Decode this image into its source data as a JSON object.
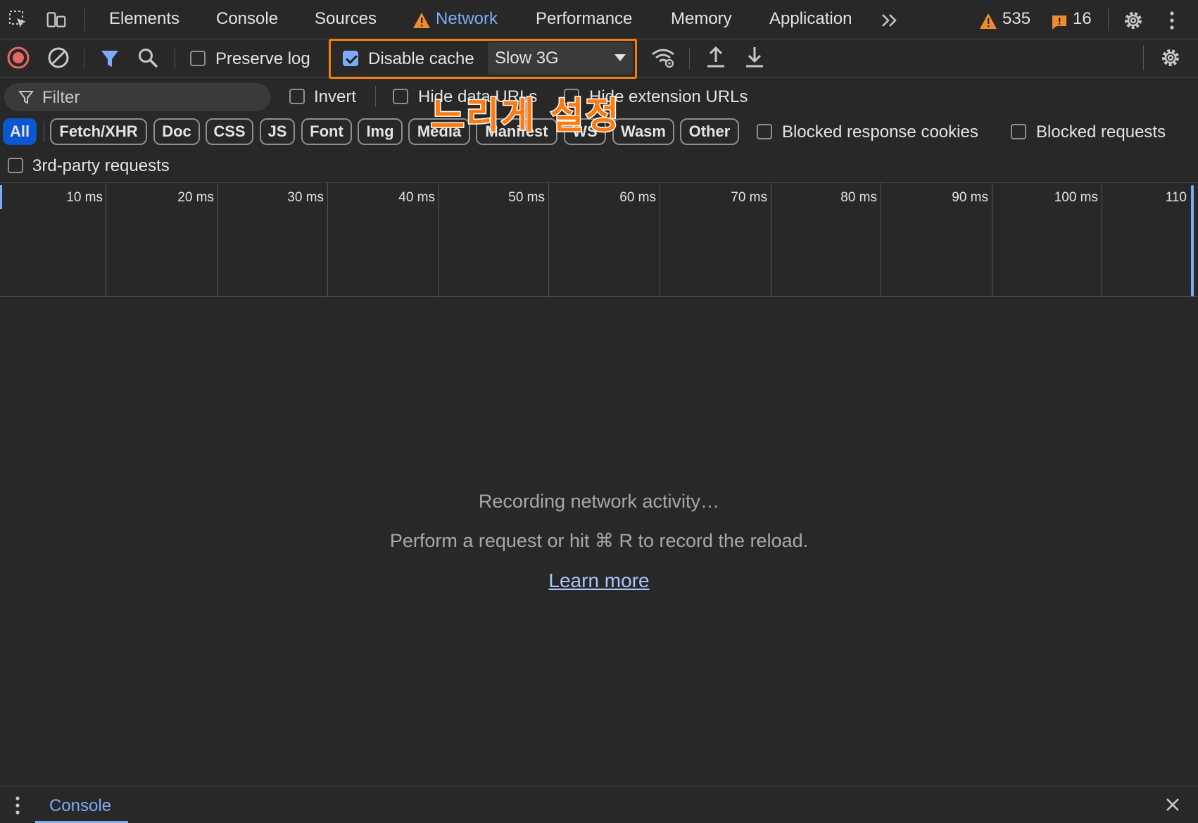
{
  "tabbar": {
    "tabs": [
      "Elements",
      "Console",
      "Sources",
      "Network",
      "Performance",
      "Memory",
      "Application"
    ],
    "active_tab": "Network",
    "more_label": ">>",
    "warnings_count": "535",
    "issues_count": "16"
  },
  "toolbar": {
    "preserve_log_label": "Preserve log",
    "preserve_log_checked": false,
    "disable_cache_label": "Disable cache",
    "disable_cache_checked": true,
    "throttle_value": "Slow 3G"
  },
  "filter": {
    "placeholder": "Filter",
    "invert_label": "Invert",
    "hide_data_urls_label": "Hide data URLs",
    "hide_extension_urls_label": "Hide extension URLs",
    "type_pills": [
      "All",
      "Fetch/XHR",
      "Doc",
      "CSS",
      "JS",
      "Font",
      "Img",
      "Media",
      "Manifest",
      "WS",
      "Wasm",
      "Other"
    ],
    "active_pill": "All",
    "blocked_response_cookies_label": "Blocked response cookies",
    "blocked_requests_label": "Blocked requests",
    "third_party_label": "3rd-party requests"
  },
  "annotation": {
    "text": "느리게 설정"
  },
  "timeline": {
    "ticks": [
      "10 ms",
      "20 ms",
      "30 ms",
      "40 ms",
      "50 ms",
      "60 ms",
      "70 ms",
      "80 ms",
      "90 ms",
      "100 ms",
      "110"
    ]
  },
  "empty_state": {
    "line1": "Recording network activity…",
    "line2": "Perform a request or hit ⌘ R to record the reload.",
    "learn_more": "Learn more"
  },
  "drawer": {
    "tab_label": "Console"
  },
  "colors": {
    "background": "#282828",
    "accent": "#7cacf8",
    "highlight": "#f07f0e",
    "warning": "#f28b30"
  }
}
